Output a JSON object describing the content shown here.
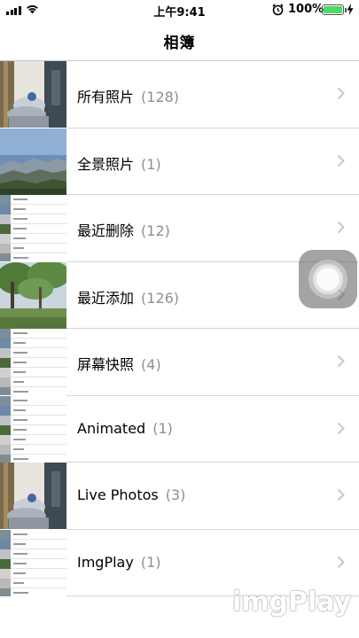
{
  "status_bar": {
    "time": "上午9:41",
    "battery_percent": "100%",
    "battery_level": 1.0,
    "battery_color": "#4cd964"
  },
  "nav": {
    "title": "相簿"
  },
  "albums": [
    {
      "name": "所有照片",
      "count": "(128)",
      "thumb": "photo-room",
      "chevron": "chevron-right-icon"
    },
    {
      "name": "全景照片",
      "count": "(1)",
      "thumb": "photo-panorama",
      "chevron": "chevron-right-icon"
    },
    {
      "name": "最近删除",
      "count": "(12)",
      "thumb": "screenshot-list",
      "chevron": "chevron-right-icon"
    },
    {
      "name": "最近添加",
      "count": "(126)",
      "thumb": "photo-trees",
      "chevron": "chevron-right-icon"
    },
    {
      "name": "屏幕快照",
      "count": "(4)",
      "thumb": "screenshot-list",
      "chevron": "chevron-right-icon"
    },
    {
      "name": "Animated",
      "count": "(1)",
      "thumb": "screenshot-list",
      "chevron": "chevron-right-icon"
    },
    {
      "name": "Live Photos",
      "count": "(3)",
      "thumb": "photo-room",
      "chevron": "chevron-right-icon"
    },
    {
      "name": "ImgPlay",
      "count": "(1)",
      "thumb": "screenshot-list",
      "chevron": "chevron-right-icon"
    }
  ],
  "watermark": {
    "text": "imgPlay"
  },
  "colors": {
    "separator": "#c8c7cc",
    "count_gray": "#8e8e93",
    "chevron": "#c7c7cc"
  }
}
